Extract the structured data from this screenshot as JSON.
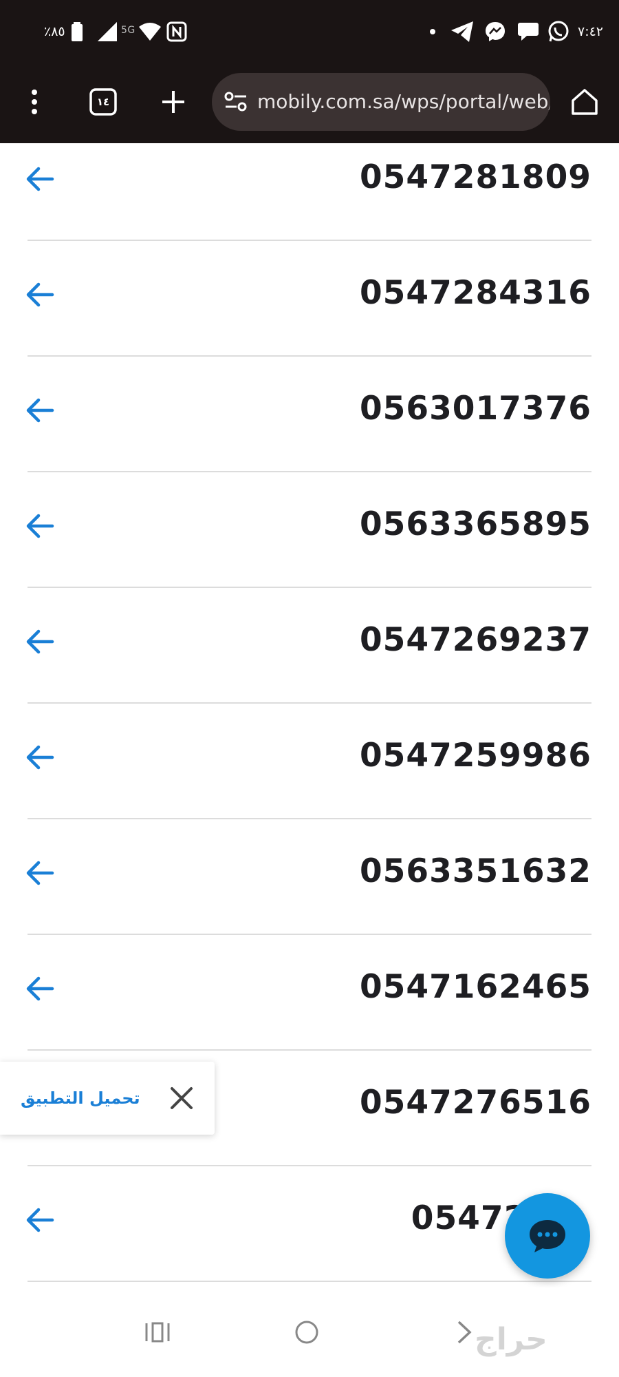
{
  "status_bar": {
    "battery_percent": "٪٨٥",
    "network_type": "5G",
    "time": "٧:٤٢",
    "icons": [
      "battery-icon",
      "signal-icon",
      "wifi-icon",
      "nfc-icon",
      "dot-icon",
      "telegram-icon",
      "messenger-icon",
      "chat-bubble-icon",
      "whatsapp-icon"
    ]
  },
  "browser": {
    "tab_count": "١٤",
    "url": "mobily.com.sa/wps/portal/web/p",
    "icons": [
      "menu-dots-icon",
      "tab-switcher-icon",
      "new-tab-icon",
      "site-settings-icon",
      "home-icon"
    ]
  },
  "numbers": [
    {
      "number": "0547281809"
    },
    {
      "number": "0547284316"
    },
    {
      "number": "0563017376"
    },
    {
      "number": "0563365895"
    },
    {
      "number": "0547269237"
    },
    {
      "number": "0547259986"
    },
    {
      "number": "0563351632"
    },
    {
      "number": "0547162465"
    },
    {
      "number": "0547276516"
    },
    {
      "number": "054726"
    }
  ],
  "download_banner": {
    "label": "تحميل التطبيق"
  },
  "chat_button": {
    "icon": "chat-icon"
  },
  "nav_bar": {
    "icons": [
      "recent-apps-icon",
      "home-circle-icon",
      "back-icon"
    ]
  },
  "watermark": {
    "text": "حراج"
  },
  "colors": {
    "accent": "#1396e0",
    "arrow": "#1a7fd6",
    "number_text": "#1e1e22",
    "status_bar_bg": "#1a1414"
  }
}
